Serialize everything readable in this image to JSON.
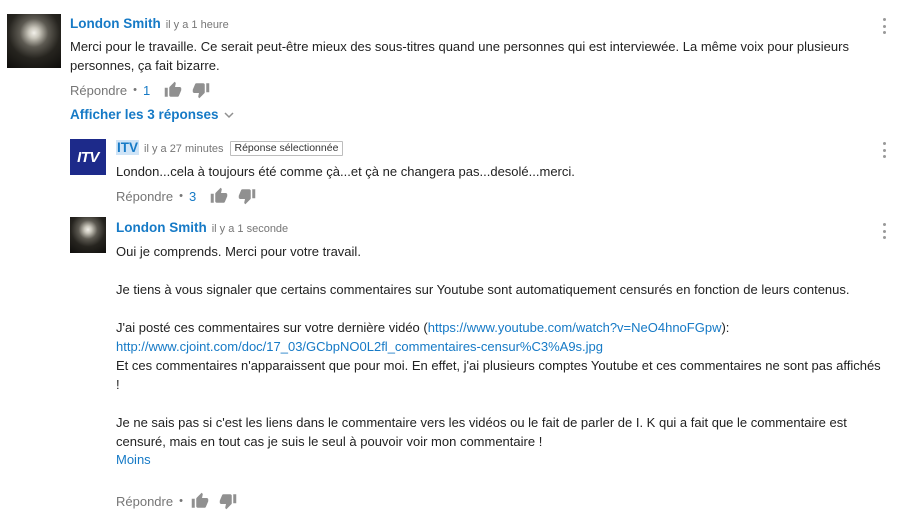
{
  "comments": [
    {
      "author": "London Smith",
      "time": "il y a 1 heure",
      "text": [
        "Merci pour le travaille. Ce serait peut-être mieux des sous-titres quand une personnes qui est interviewée. La même voix pour plusieurs personnes, ça fait bizarre."
      ],
      "reply_label": "Répondre",
      "likes": "1"
    },
    {
      "author": "ITV",
      "avatar_text": "ITV",
      "time": "il y a 27 minutes",
      "badge": "Réponse sélectionnée",
      "text": [
        "London...cela à toujours été comme çà...et çà ne changera pas...desolé...merci."
      ],
      "reply_label": "Répondre",
      "likes": "3"
    },
    {
      "author": "London Smith",
      "time": "il y a 1 seconde",
      "p1": "Oui je comprends. Merci pour votre travail.",
      "p2": "Je tiens à vous signaler que certains commentaires sur Youtube sont automatiquement censurés en fonction de leurs contenus.",
      "p3_before": "J'ai posté ces commentaires sur votre dernière vidéo (",
      "p3_link1": "https://www.youtube.com/watch?v=NeO4hnoFGpw",
      "p3_after": "):",
      "p3_link2": "http://www.cjoint.com/doc/17_03/GCbpNO0L2fl_commentaires-censur%C3%A9s.jpg",
      "p4": "Et ces commentaires n'apparaissent que pour moi. En effet, j'ai plusieurs comptes Youtube et ces commentaires ne sont pas affichés !",
      "p5": "Je ne sais pas si c'est les liens dans le commentaire vers les vidéos ou le fait de parler de I. K qui a fait que le commentaire est censuré, mais en tout cas je suis le seul à pouvoir voir mon commentaire !",
      "less_label": "Moins",
      "reply_label": "Répondre"
    }
  ],
  "show_replies_label": "Afficher les 3 réponses",
  "icons": {
    "like": "thumbs-up-icon",
    "dislike": "thumbs-down-icon",
    "menu": "more-vert-icon",
    "expand": "chevron-down-icon"
  },
  "colors": {
    "link": "#167ac6",
    "muted": "#767676",
    "highlight": "#cfe4f7",
    "itv_brand": "#1d2a8a"
  }
}
